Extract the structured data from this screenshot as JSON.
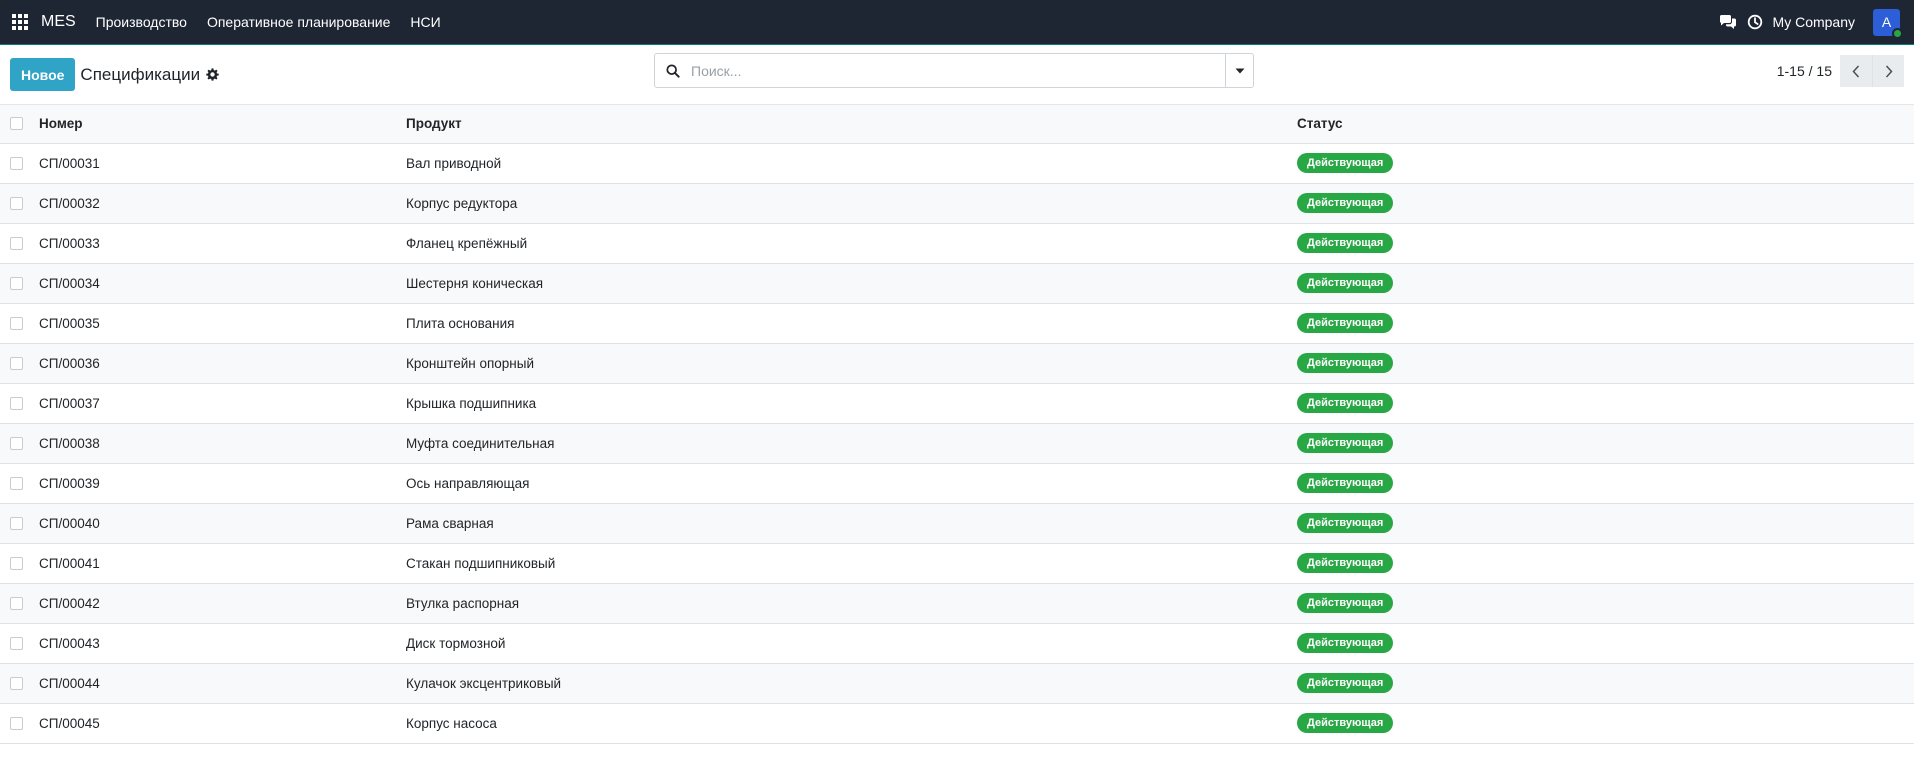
{
  "navbar": {
    "brand": "MES",
    "menu": [
      "Производство",
      "Оперативное планирование",
      "НСИ"
    ],
    "company": "My Company",
    "avatar_letter": "A"
  },
  "control": {
    "new_button": "Новое",
    "title": "Спецификации",
    "search_placeholder": "Поиск...",
    "pager": "1-15 / 15"
  },
  "table": {
    "headers": [
      "Номер",
      "Продукт",
      "Статус"
    ],
    "rows": [
      {
        "number": "СП/00031",
        "product": "Вал приводной",
        "status": "Действующая"
      },
      {
        "number": "СП/00032",
        "product": "Корпус редуктора",
        "status": "Действующая"
      },
      {
        "number": "СП/00033",
        "product": "Фланец крепёжный",
        "status": "Действующая"
      },
      {
        "number": "СП/00034",
        "product": "Шестерня коническая",
        "status": "Действующая"
      },
      {
        "number": "СП/00035",
        "product": "Плита основания",
        "status": "Действующая"
      },
      {
        "number": "СП/00036",
        "product": "Кронштейн опорный",
        "status": "Действующая"
      },
      {
        "number": "СП/00037",
        "product": "Крышка подшипника",
        "status": "Действующая"
      },
      {
        "number": "СП/00038",
        "product": "Муфта соединительная",
        "status": "Действующая"
      },
      {
        "number": "СП/00039",
        "product": "Ось направляющая",
        "status": "Действующая"
      },
      {
        "number": "СП/00040",
        "product": "Рама сварная",
        "status": "Действующая"
      },
      {
        "number": "СП/00041",
        "product": "Стакан подшипниковый",
        "status": "Действующая"
      },
      {
        "number": "СП/00042",
        "product": "Втулка распорная",
        "status": "Действующая"
      },
      {
        "number": "СП/00043",
        "product": "Диск тормозной",
        "status": "Действующая"
      },
      {
        "number": "СП/00044",
        "product": "Кулачок эксцентриковый",
        "status": "Действующая"
      },
      {
        "number": "СП/00045",
        "product": "Корпус насоса",
        "status": "Действующая"
      }
    ]
  }
}
